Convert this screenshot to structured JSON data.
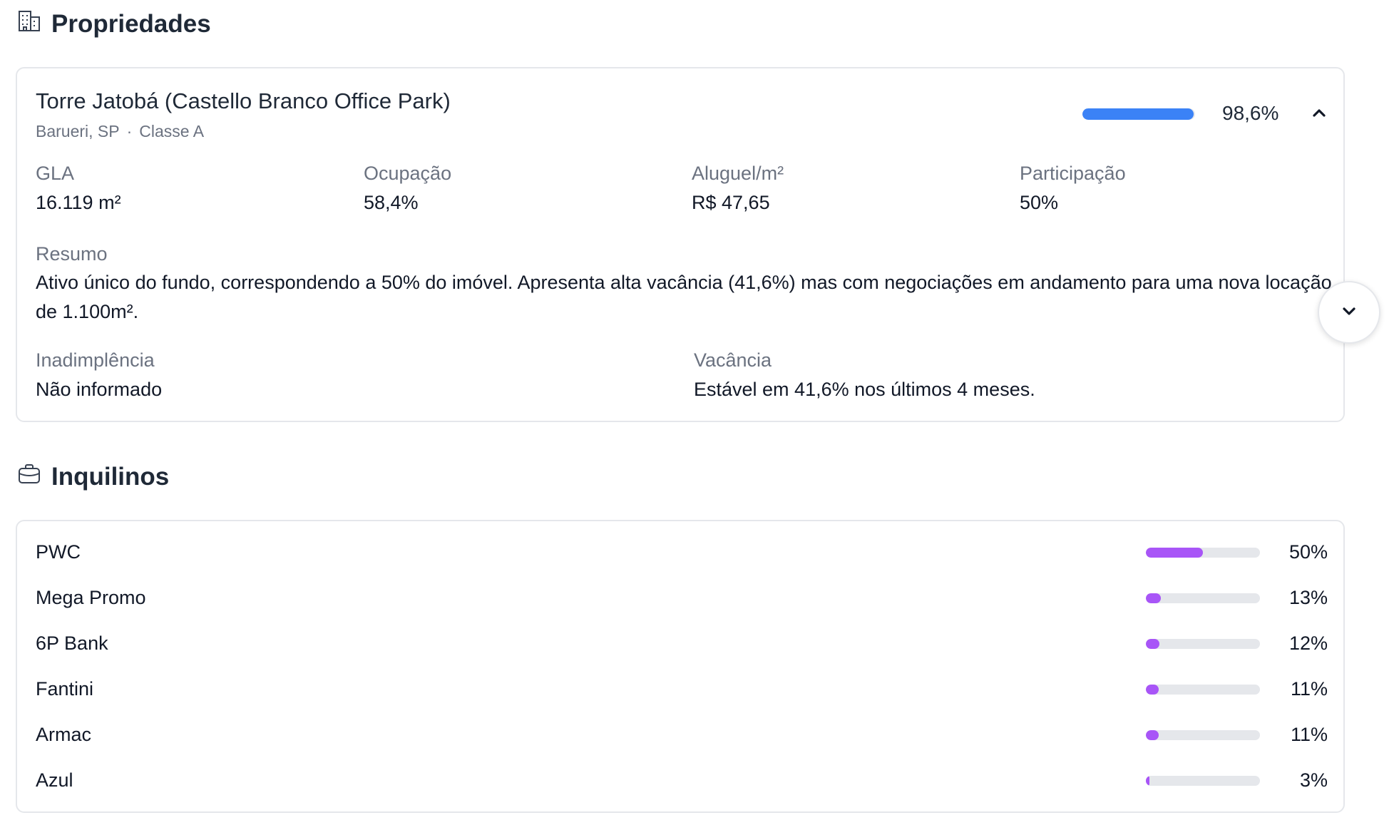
{
  "properties_section": {
    "title": "Propriedades",
    "icon": "building-icon"
  },
  "property": {
    "name": "Torre Jatobá (Castello Branco Office Park)",
    "location": "Barueri, SP",
    "separator": "·",
    "class": "Classe A",
    "occupancy_bar": {
      "fraction": 0.986,
      "label": "98,6%",
      "color": "#3b82f6"
    },
    "toggle_icon": "chevron-up-icon",
    "metrics": [
      {
        "label": "GLA",
        "value": "16.119 m²"
      },
      {
        "label": "Ocupação",
        "value": "58,4%"
      },
      {
        "label": "Aluguel/m²",
        "value": "R$ 47,65"
      },
      {
        "label": "Participação",
        "value": "50%"
      }
    ],
    "summary": {
      "label": "Resumo",
      "text": "Ativo único do fundo, correspondendo a 50% do imóvel. Apresenta alta vacância (41,6%) mas com negociações em andamento para uma nova locação de 1.100m²."
    },
    "default": {
      "label": "Inadimplência",
      "value": "Não informado"
    },
    "vacancy": {
      "label": "Vacância",
      "value": "Estável em 41,6% nos últimos 4 meses."
    }
  },
  "scroll_button": {
    "icon": "chevron-down-icon"
  },
  "tenants_section": {
    "title": "Inquilinos",
    "icon": "briefcase-icon"
  },
  "tenants": [
    {
      "name": "PWC",
      "percent": "50%",
      "fraction": 0.5
    },
    {
      "name": "Mega Promo",
      "percent": "13%",
      "fraction": 0.13
    },
    {
      "name": "6P Bank",
      "percent": "12%",
      "fraction": 0.12
    },
    {
      "name": "Fantini",
      "percent": "11%",
      "fraction": 0.11
    },
    {
      "name": "Armac",
      "percent": "11%",
      "fraction": 0.11
    },
    {
      "name": "Azul",
      "percent": "3%",
      "fraction": 0.03
    }
  ],
  "colors": {
    "tenant_bar": "#a855f7",
    "bar_track": "#e5e7eb",
    "muted_text": "#6b7280"
  }
}
